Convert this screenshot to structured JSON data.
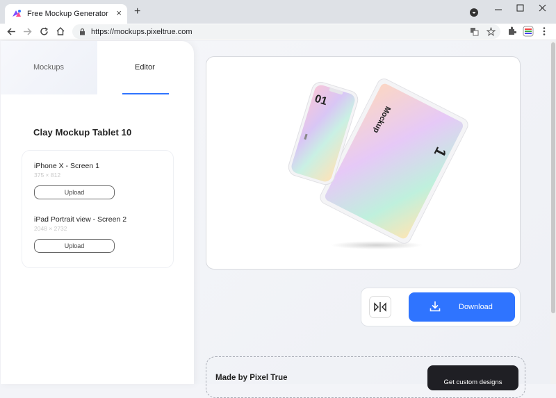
{
  "browser": {
    "tab_title": "Free Mockup Generator",
    "tab_close": "×",
    "new_tab": "+",
    "url": "https://mockups.pixeltrue.com"
  },
  "sidebar": {
    "tabs": [
      {
        "label": "Mockups"
      },
      {
        "label": "Editor"
      }
    ],
    "active_tab": "Editor",
    "mockup_title": "Clay Mockup Tablet 10",
    "screens": [
      {
        "name": "iPhone X - Screen 1",
        "size": "375 × 812",
        "button": "Upload"
      },
      {
        "name": "iPad Portrait view - Screen 2",
        "size": "2048 × 2732",
        "button": "Upload"
      }
    ]
  },
  "preview": {
    "phone_text": "01",
    "tablet_text": "Mockup",
    "tablet_number": "1"
  },
  "actions": {
    "download_label": "Download"
  },
  "footer": {
    "made_by": "Made by Pixel True",
    "custom_button": "Get custom designs"
  },
  "colors": {
    "accent": "#2f74ff",
    "dark_button": "#1f1f24"
  }
}
